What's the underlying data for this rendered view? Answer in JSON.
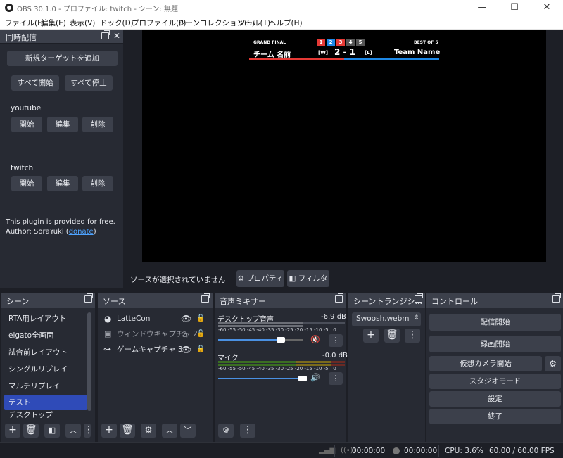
{
  "window": {
    "title": "OBS 30.1.0 - プロファイル: twitch - シーン: 無題",
    "minimize": "—",
    "maximize": "☐",
    "close": "✕"
  },
  "menu": [
    "ファイル(F)",
    "編集(E)",
    "表示(V)",
    "ドック(D)",
    "プロファイル(P)",
    "シーンコレクション(S)",
    "ツール(T)",
    "ヘルプ(H)"
  ],
  "multistream": {
    "title": "同時配信",
    "add_target": "新規ターゲットを追加",
    "start_all": "すべて開始",
    "stop_all": "すべて停止",
    "targets": [
      {
        "name": "youtube",
        "start": "開始",
        "edit": "編集",
        "delete": "削除"
      },
      {
        "name": "twitch",
        "start": "開始",
        "edit": "編集",
        "delete": "削除"
      }
    ],
    "plugin_note": "This plugin is provided for free.",
    "author_prefix": "Author: SoraYuki (",
    "author_link": "donate",
    "author_suffix": ")"
  },
  "overlay": {
    "stage": "GRAND FINAL",
    "best_of": "BEST OF 5",
    "games": [
      "1",
      "2",
      "3",
      "4",
      "5"
    ],
    "team_left": "チーム 名前",
    "tag_left": "[W]",
    "score": "2 - 1",
    "tag_right": "[L]",
    "team_right": "Team Name",
    "colors": {
      "red": "#e53935",
      "blue": "#1e88e5",
      "gray": "#555555"
    }
  },
  "preview_toolbar": {
    "no_source": "ソースが選択されていません",
    "properties": "プロパティ",
    "filters": "フィルタ"
  },
  "scenes": {
    "title": "シーン",
    "items": [
      "RTA用レイアウト",
      "elgato全画面",
      "試合前レイアウト",
      "シングルリプレイ",
      "マルチリプレイ",
      "テスト",
      "デスクトップ"
    ],
    "selected": "テスト"
  },
  "sources": {
    "title": "ソース",
    "items": [
      {
        "name": "LatteCon",
        "icon": "globe-icon"
      },
      {
        "name": "ウィンドウキャプチャ 2",
        "icon": "window-icon"
      },
      {
        "name": "ゲームキャプチャ 3",
        "icon": "gamepad-icon"
      }
    ]
  },
  "mixer": {
    "title": "音声ミキサー",
    "channels": [
      {
        "name": "デスクトップ音声",
        "db": "-6.9 dB",
        "muted": true
      },
      {
        "name": "マイク",
        "db": "-0.0 dB",
        "muted": false
      }
    ],
    "ticks": [
      "-60",
      "-55",
      "-50",
      "-45",
      "-40",
      "-35",
      "-30",
      "-25",
      "-20",
      "-15",
      "-10",
      "-5",
      "0"
    ]
  },
  "transitions": {
    "title": "シーントランジシ...",
    "selected": "Swoosh.webm"
  },
  "controls": {
    "title": "コントロール",
    "start_stream": "配信開始",
    "start_record": "録画開始",
    "virtual_cam": "仮想カメラ開始",
    "studio_mode": "スタジオモード",
    "settings": "設定",
    "exit": "終了"
  },
  "status": {
    "stream_time": "00:00:00",
    "record_time": "00:00:00",
    "cpu": "CPU: 3.6%",
    "fps": "60.00 / 60.00 FPS"
  }
}
